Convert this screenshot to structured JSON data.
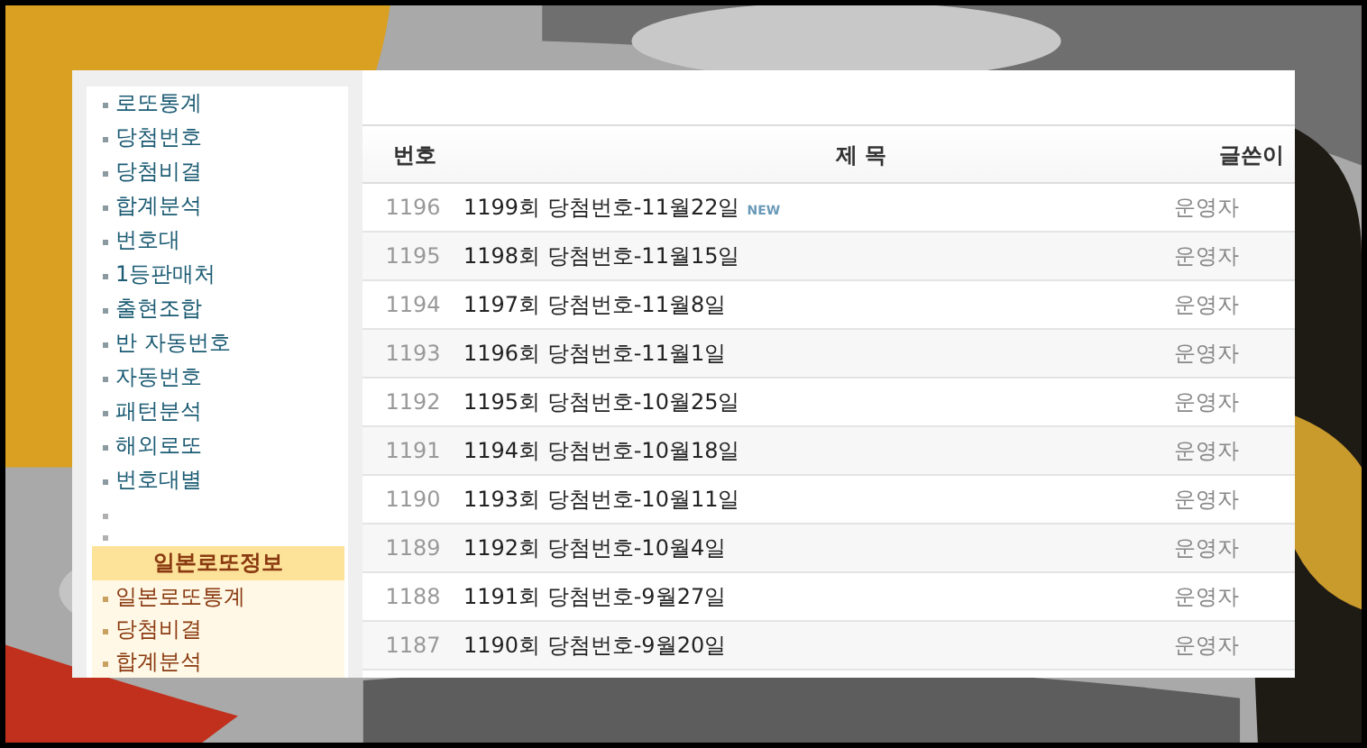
{
  "sidebar": {
    "items": [
      {
        "kind": "link",
        "label": "로또통계"
      },
      {
        "kind": "link",
        "label": "당첨번호"
      },
      {
        "kind": "link",
        "label": "당첨비결"
      },
      {
        "kind": "link",
        "label": "합계분석"
      },
      {
        "kind": "link",
        "label": "번호대"
      },
      {
        "kind": "link",
        "label": "1등판매처"
      },
      {
        "kind": "link",
        "label": "출현조합"
      },
      {
        "kind": "link",
        "label": "반 자동번호"
      },
      {
        "kind": "link",
        "label": "자동번호"
      },
      {
        "kind": "link",
        "label": "패턴분석"
      },
      {
        "kind": "link",
        "label": "해외로또"
      },
      {
        "kind": "link",
        "label": "번호대별"
      },
      {
        "kind": "blank"
      },
      {
        "kind": "blank"
      }
    ],
    "section": {
      "title": "일본로또정보",
      "items": [
        "일본로또통계",
        "당첨비결",
        "합계분석"
      ]
    }
  },
  "table": {
    "columns": [
      "번호",
      "제 목",
      "글쓴이"
    ],
    "rows": [
      {
        "number": "1196",
        "title": "1199회 당첨번호-11월22일",
        "badge": "NEW",
        "author": "운영자"
      },
      {
        "number": "1195",
        "title": "1198회 당첨번호-11월15일",
        "author": "운영자"
      },
      {
        "number": "1194",
        "title": "1197회 당첨번호-11월8일",
        "author": "운영자"
      },
      {
        "number": "1193",
        "title": "1196회 당첨번호-11월1일",
        "author": "운영자"
      },
      {
        "number": "1192",
        "title": "1195회 당첨번호-10월25일",
        "author": "운영자"
      },
      {
        "number": "1191",
        "title": "1194회 당첨번호-10월18일",
        "author": "운영자"
      },
      {
        "number": "1190",
        "title": "1193회 당첨번호-10월11일",
        "author": "운영자"
      },
      {
        "number": "1189",
        "title": "1192회 당첨번호-10월4일",
        "author": "운영자"
      },
      {
        "number": "1188",
        "title": "1191회 당첨번호-9월27일",
        "author": "운영자"
      },
      {
        "number": "1187",
        "title": "1190회 당첨번호-9월20일",
        "author": "운영자"
      }
    ]
  }
}
